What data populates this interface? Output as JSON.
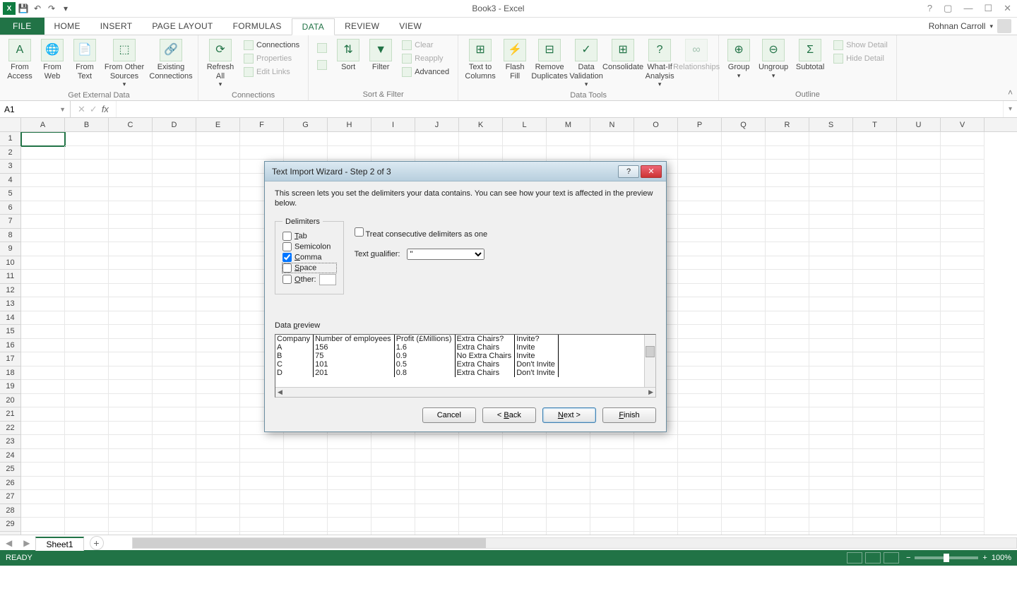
{
  "app": {
    "title": "Book3 - Excel",
    "user": "Rohnan Carroll"
  },
  "qat": {
    "save": "💾",
    "undo": "↶",
    "redo": "↷"
  },
  "tabs": [
    "FILE",
    "HOME",
    "INSERT",
    "PAGE LAYOUT",
    "FORMULAS",
    "DATA",
    "REVIEW",
    "VIEW"
  ],
  "active_tab": "DATA",
  "ribbon": {
    "groups": {
      "get_external": {
        "label": "Get External Data",
        "from_access": "From Access",
        "from_web": "From Web",
        "from_text": "From Text",
        "from_other": "From Other Sources",
        "existing": "Existing Connections"
      },
      "connections": {
        "label": "Connections",
        "refresh": "Refresh All",
        "connections": "Connections",
        "properties": "Properties",
        "edit_links": "Edit Links"
      },
      "sort_filter": {
        "label": "Sort & Filter",
        "sort": "Sort",
        "filter": "Filter",
        "clear": "Clear",
        "reapply": "Reapply",
        "advanced": "Advanced"
      },
      "data_tools": {
        "label": "Data Tools",
        "text_to_columns": "Text to Columns",
        "flash_fill": "Flash Fill",
        "remove_dup": "Remove Duplicates",
        "validation": "Data Validation",
        "consolidate": "Consolidate",
        "whatif": "What-If Analysis",
        "relationships": "Relationships"
      },
      "outline": {
        "label": "Outline",
        "group": "Group",
        "ungroup": "Ungroup",
        "subtotal": "Subtotal",
        "show_detail": "Show Detail",
        "hide_detail": "Hide Detail"
      }
    }
  },
  "namebox": "A1",
  "columns": [
    "A",
    "B",
    "C",
    "D",
    "E",
    "F",
    "G",
    "H",
    "I",
    "J",
    "K",
    "L",
    "M",
    "N",
    "O",
    "P",
    "Q",
    "R",
    "S",
    "T",
    "U",
    "V"
  ],
  "row_count": 30,
  "sheet": {
    "name": "Sheet1"
  },
  "status": {
    "ready": "READY",
    "zoom": "100%"
  },
  "dialog": {
    "title": "Text Import Wizard - Step 2 of 3",
    "description": "This screen lets you set the delimiters your data contains.  You can see how your text is affected in the preview below.",
    "delimiters_legend": "Delimiters",
    "delim": {
      "tab": "Tab",
      "semicolon": "Semicolon",
      "comma": "Comma",
      "space": "Space",
      "other": "Other:"
    },
    "checked": {
      "tab": false,
      "semicolon": false,
      "comma": true,
      "space": false,
      "other": false
    },
    "treat_consecutive": "Treat consecutive delimiters as one",
    "text_qualifier_label": "Text qualifier:",
    "text_qualifier_value": "\"",
    "preview_label": "Data preview",
    "preview": {
      "headers": [
        "Company",
        "Number of employees",
        "Profit (£Millions)",
        "Extra Chairs?",
        "Invite?"
      ],
      "rows": [
        [
          "A",
          "156",
          "1.6",
          "Extra Chairs",
          "Invite"
        ],
        [
          "B",
          "75",
          "0.9",
          "No Extra Chairs",
          "Invite"
        ],
        [
          "C",
          "101",
          "0.5",
          "Extra Chairs",
          "Don't Invite"
        ],
        [
          "D",
          "201",
          "0.8",
          "Extra Chairs",
          "Don't Invite"
        ]
      ]
    },
    "buttons": {
      "cancel": "Cancel",
      "back": "< Back",
      "next": "Next >",
      "finish": "Finish"
    }
  }
}
